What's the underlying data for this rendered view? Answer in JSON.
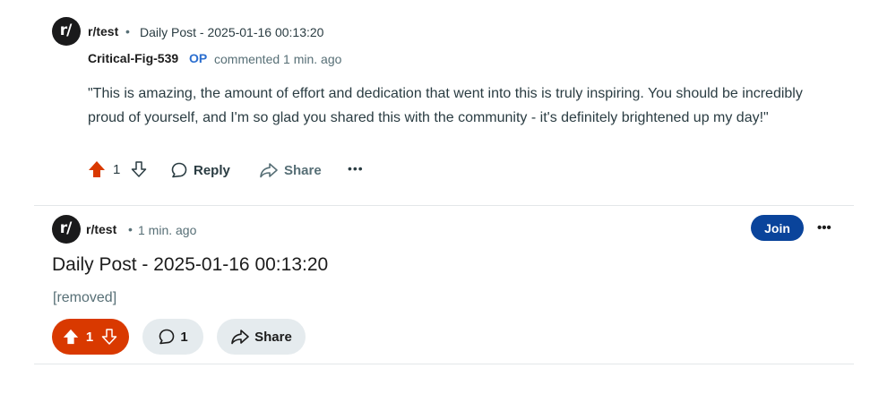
{
  "comment": {
    "subreddit_icon_text": "r/",
    "subreddit": "r/test",
    "separator": "•",
    "post_title": "Daily Post - 2025-01-16 00:13:20",
    "author": "Critical-Fig-539",
    "op_badge": "OP",
    "meta": "commented 1 min. ago",
    "body": "\"This is amazing, the amount of effort and dedication that went into this is truly inspiring. You should be incredibly proud of yourself, and I'm so glad you shared this with the community - it's definitely brightened up my day!\"",
    "score": "1",
    "upvoted": true,
    "reply_label": "Reply",
    "share_label": "Share",
    "more_label": "•••"
  },
  "post": {
    "subreddit_icon_text": "r/",
    "subreddit": "r/test",
    "separator": "•",
    "time": "1 min. ago",
    "join_label": "Join",
    "more_label": "•••",
    "title": "Daily Post - 2025-01-16 00:13:20",
    "body": "[removed]",
    "score": "1",
    "upvoted": true,
    "comment_count": "1",
    "share_label": "Share"
  },
  "colors": {
    "upvote_active": "#d93900",
    "join_button": "#0a449b",
    "op_badge": "#2b6ecf",
    "pill_bg": "#e5ebee"
  },
  "icons": [
    "subreddit-avatar-icon",
    "upvote-icon",
    "downvote-icon",
    "comment-icon",
    "share-icon",
    "more-icon"
  ]
}
